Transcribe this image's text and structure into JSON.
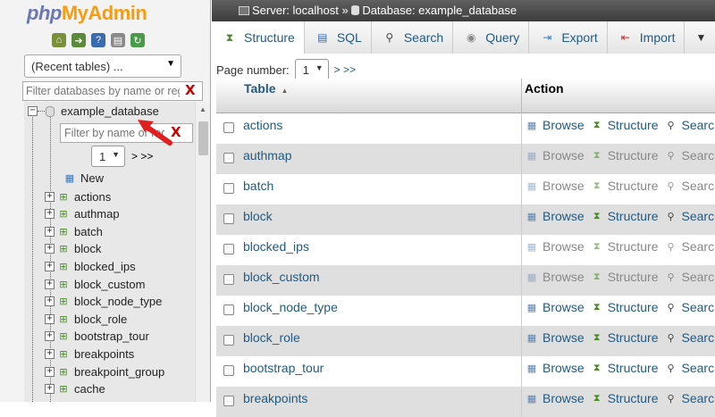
{
  "logo": {
    "php": "php",
    "my": "MyAdmin"
  },
  "nav": {
    "recent_select": "(Recent tables) ...",
    "db_filter_placeholder": "Filter databases by name or regex",
    "clear_label": "X",
    "database": "example_database",
    "table_filter_placeholder": "Filter by name or regex",
    "page_value": "1",
    "page_nav": "> >>",
    "new_label": "New",
    "tables": [
      "actions",
      "authmap",
      "batch",
      "block",
      "blocked_ips",
      "block_custom",
      "block_node_type",
      "block_role",
      "bootstrap_tour",
      "breakpoints",
      "breakpoint_group",
      "cache"
    ]
  },
  "breadcrumb": {
    "server": "Server: localhost",
    "separator": "»",
    "database": "Database: example_database"
  },
  "tabs": [
    {
      "label": "Structure",
      "icon": "structure-icon"
    },
    {
      "label": "SQL",
      "icon": "sql-icon"
    },
    {
      "label": "Search",
      "icon": "search-icon"
    },
    {
      "label": "Query",
      "icon": "query-icon"
    },
    {
      "label": "Export",
      "icon": "export-icon"
    },
    {
      "label": "Import",
      "icon": "import-icon"
    },
    {
      "label": "",
      "icon": "more-icon"
    }
  ],
  "pager": {
    "label": "Page number:",
    "value": "1",
    "nav": "> >>"
  },
  "table_header": {
    "table": "Table",
    "action": "Action"
  },
  "actions": {
    "browse": "Browse",
    "structure": "Structure",
    "search": "Search"
  },
  "rows": [
    {
      "name": "actions",
      "empty": false
    },
    {
      "name": "authmap",
      "empty": true
    },
    {
      "name": "batch",
      "empty": true
    },
    {
      "name": "block",
      "empty": false
    },
    {
      "name": "blocked_ips",
      "empty": true
    },
    {
      "name": "block_custom",
      "empty": true
    },
    {
      "name": "block_node_type",
      "empty": false
    },
    {
      "name": "block_role",
      "empty": false
    },
    {
      "name": "bootstrap_tour",
      "empty": false
    },
    {
      "name": "breakpoints",
      "empty": false
    }
  ],
  "colors": {
    "link": "#235a81",
    "accent_orange": "#f89c0e",
    "logo_blue": "#6c78af",
    "clear_red": "#cc0000",
    "arrow_red": "#e02020"
  }
}
